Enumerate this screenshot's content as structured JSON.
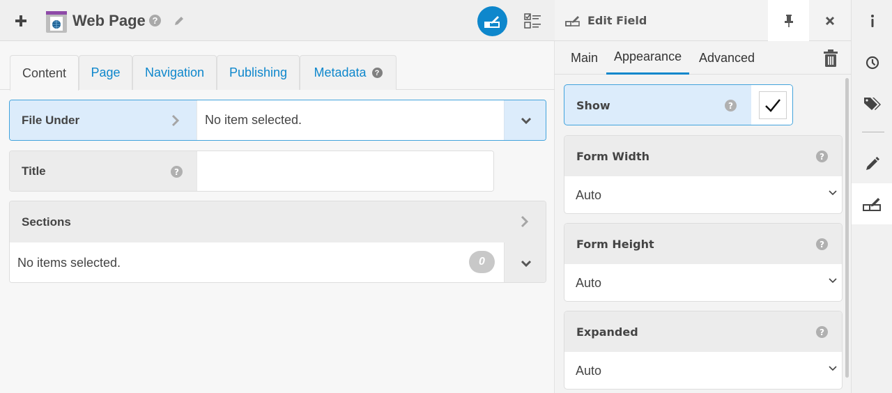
{
  "header": {
    "add_label": "+",
    "title": "Web Page",
    "help": "?",
    "icons": {
      "add": "plus-icon",
      "doc_type": "web-page-icon",
      "help": "help-icon",
      "edit": "pencil-icon",
      "assign": "edit-field-icon",
      "checklist": "checklist-icon"
    }
  },
  "tabs": [
    {
      "label": "Content",
      "active": true
    },
    {
      "label": "Page",
      "active": false
    },
    {
      "label": "Navigation",
      "active": false
    },
    {
      "label": "Publishing",
      "active": false
    },
    {
      "label": "Metadata",
      "active": false,
      "help": "?"
    }
  ],
  "fields": {
    "file_under": {
      "label": "File Under",
      "value": "No item selected."
    },
    "title": {
      "label": "Title",
      "value": "",
      "help": "?"
    },
    "sections": {
      "label": "Sections",
      "value": "No items selected.",
      "count": "0"
    }
  },
  "panel": {
    "title": "Edit Field",
    "tabs": [
      {
        "label": "Main",
        "active": false
      },
      {
        "label": "Appearance",
        "active": true
      },
      {
        "label": "Advanced",
        "active": false
      }
    ],
    "show": {
      "label": "Show",
      "checked": true,
      "help": "?",
      "check_glyph": "✓"
    },
    "selects": [
      {
        "label": "Form Width",
        "value": "Auto",
        "help": "?"
      },
      {
        "label": "Form Height",
        "value": "Auto",
        "help": "?"
      },
      {
        "label": "Expanded",
        "value": "Auto",
        "help": "?"
      }
    ]
  },
  "rail": [
    {
      "name": "info-icon",
      "active": false
    },
    {
      "name": "history-icon",
      "active": false
    },
    {
      "name": "tags-icon",
      "active": false
    },
    {
      "name": "pencil-icon",
      "active": false
    },
    {
      "name": "edit-field-icon",
      "active": true
    }
  ],
  "colors": {
    "accent": "#0e87cc",
    "selected_bg": "#dcecfb",
    "selected_border": "#42a3dc",
    "badge": "#c8c8c8"
  }
}
